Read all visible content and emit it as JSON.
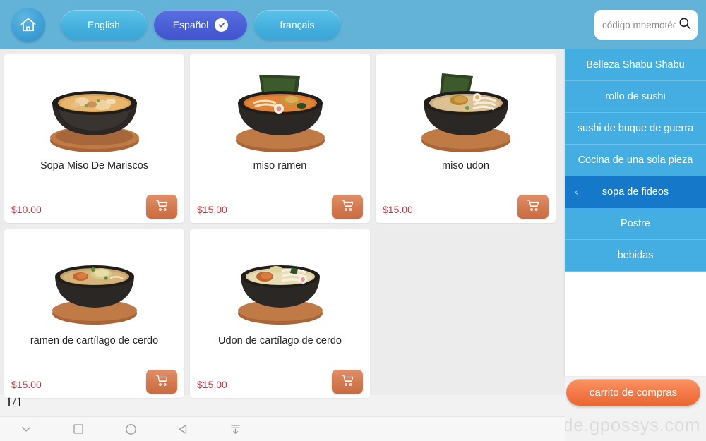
{
  "header": {
    "home_icon": "home-icon",
    "languages": [
      {
        "label": "English",
        "selected": false
      },
      {
        "label": "Español",
        "selected": true
      },
      {
        "label": "français",
        "selected": false
      }
    ],
    "search": {
      "placeholder": "código mnemotécn",
      "value": "",
      "icon": "search-icon"
    },
    "bg_color": "#63b3d9",
    "active_lang_color": "#4a5fd6"
  },
  "products": [
    {
      "name": "Sopa Miso De Mariscos",
      "price": "$10.00",
      "cart_icon": "shopping-cart-icon",
      "image": "seafood-miso-soup-bowl"
    },
    {
      "name": "miso ramen",
      "price": "$15.00",
      "cart_icon": "shopping-cart-icon",
      "image": "miso-ramen-bowl"
    },
    {
      "name": "miso udon",
      "price": "$15.00",
      "cart_icon": "shopping-cart-icon",
      "image": "miso-udon-bowl"
    },
    {
      "name": "ramen de cartílago de cerdo",
      "price": "$15.00",
      "cart_icon": "shopping-cart-icon",
      "image": "pork-cartilage-ramen-bowl"
    },
    {
      "name": "Udon de cartílago de cerdo",
      "price": "$15.00",
      "cart_icon": "shopping-cart-icon",
      "image": "pork-cartilage-udon-bowl"
    }
  ],
  "pagination": {
    "label": "1/1"
  },
  "sidebar": {
    "categories": [
      {
        "label": "Belleza Shabu Shabu",
        "selected": false
      },
      {
        "label": "rollo de sushi",
        "selected": false
      },
      {
        "label": "sushi de buque de guerra",
        "selected": false
      },
      {
        "label": "Cocina de una sola pieza",
        "selected": false
      },
      {
        "label": "sopa de fideos",
        "selected": true
      },
      {
        "label": "Postre",
        "selected": false
      },
      {
        "label": "bebidas",
        "selected": false
      }
    ],
    "item_color": "#44ade2",
    "selected_color": "#1578c8"
  },
  "checkout": {
    "label": "carrito de compras",
    "color": "#f4794a"
  },
  "watermark": {
    "text": "de.gpossys.com"
  },
  "navbar": {
    "icons": [
      "chevron-down-icon",
      "square-icon",
      "circle-icon",
      "triangle-left-back-icon",
      "collapse-down-icon"
    ]
  },
  "colors": {
    "price": "#d0343f",
    "content_bg": "#ececec",
    "card_bg": "#ffffff"
  }
}
